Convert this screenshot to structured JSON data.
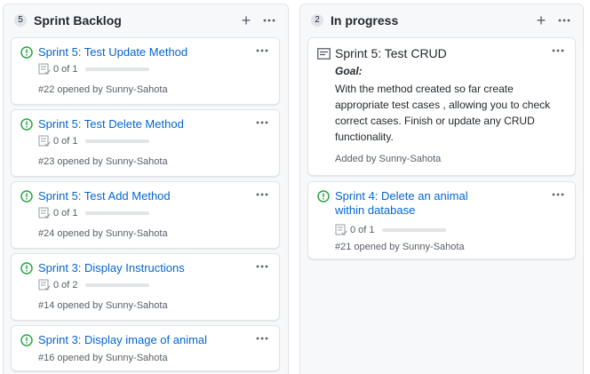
{
  "colors": {
    "link": "#0366d6",
    "open_issue_green": "#28a745",
    "muted": "#586069",
    "column_bg": "#f6f8fa",
    "border": "#e1e4e8"
  },
  "columns": [
    {
      "count": "5",
      "title": "Sprint Backlog",
      "add_icon": "plus-icon",
      "menu_icon": "kebab-horizontal-icon",
      "cards": [
        {
          "icon": "issue-opened-icon",
          "title": "Sprint 5: Test Update Method",
          "progress_text": "0 of 1",
          "progress": 0,
          "meta": "#22 opened by Sunny-Sahota"
        },
        {
          "icon": "issue-opened-icon",
          "title": "Sprint 5: Test Delete Method",
          "progress_text": "0 of 1",
          "progress": 0,
          "meta": "#23 opened by Sunny-Sahota"
        },
        {
          "icon": "issue-opened-icon",
          "title": "Sprint 5: Test Add Method",
          "progress_text": "0 of 1",
          "progress": 0,
          "meta": "#24 opened by Sunny-Sahota"
        },
        {
          "icon": "issue-opened-icon",
          "title": "Sprint 3: Display Instructions",
          "progress_text": "0 of 2",
          "progress": 0,
          "meta": "#14 opened by Sunny-Sahota"
        },
        {
          "icon": "issue-opened-icon",
          "title": "Sprint 3: Display image of animal",
          "meta": "#16 opened by Sunny-Sahota"
        }
      ]
    },
    {
      "count": "2",
      "title": "In progress",
      "add_icon": "plus-icon",
      "menu_icon": "kebab-horizontal-icon",
      "note": {
        "icon": "note-icon",
        "title": "Sprint 5: Test CRUD",
        "goal_label": "Goal:",
        "body": "With the method created so far create appropriate test cases , allowing you to check correct cases. Finish or update any CRUD functionality.",
        "added_by": "Added by Sunny-Sahota"
      },
      "cards": [
        {
          "icon": "issue-opened-icon",
          "title": "Sprint 4: Delete an animal within database",
          "progress_text": "0 of 1",
          "progress": 0,
          "meta": "#21 opened by Sunny-Sahota"
        }
      ]
    }
  ]
}
